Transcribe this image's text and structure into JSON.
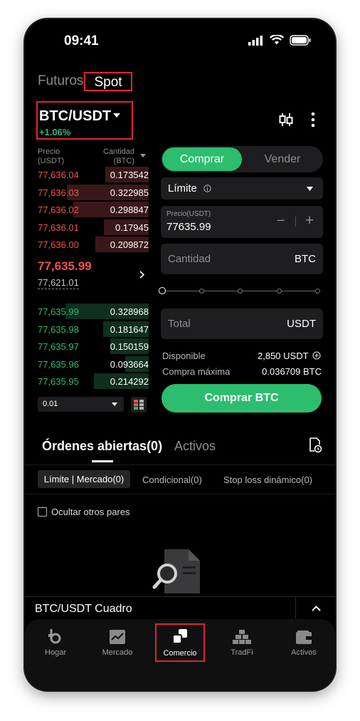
{
  "status_bar": {
    "time": "09:41"
  },
  "top_tabs": {
    "futures": "Futuros",
    "spot": "Spot"
  },
  "pair": {
    "name": "BTC/USDT",
    "change": "+1.06%"
  },
  "order_book": {
    "header_price": "Precio",
    "header_price_unit": "(USDT)",
    "header_qty": "Cantidad",
    "header_qty_unit": "(BTC)",
    "asks": [
      {
        "price": "77,636.04",
        "qty": "0.173542",
        "depth": 0.35
      },
      {
        "price": "77,636.03",
        "qty": "0.322985",
        "depth": 0.66
      },
      {
        "price": "77,636.02",
        "qty": "0.298847",
        "depth": 0.61
      },
      {
        "price": "77,636.01",
        "qty": "0.17945",
        "depth": 0.36
      },
      {
        "price": "77,636.00",
        "qty": "0.209872",
        "depth": 0.43
      }
    ],
    "last_price": "77,635.99",
    "mark_price": "77,621.01",
    "bids": [
      {
        "price": "77,635.99",
        "qty": "0.328968",
        "depth": 0.67
      },
      {
        "price": "77,635.98",
        "qty": "0.181647",
        "depth": 0.37
      },
      {
        "price": "77,635.97",
        "qty": "0.150159",
        "depth": 0.31
      },
      {
        "price": "77,635.96",
        "qty": "0.093664",
        "depth": 0.19
      },
      {
        "price": "77,635.95",
        "qty": "0.214292",
        "depth": 0.44
      }
    ],
    "precision": "0.01"
  },
  "trade_form": {
    "buy_label": "Comprar",
    "sell_label": "Vender",
    "order_type": "Límite",
    "price_label": "Precio(USDT)",
    "price_value": "77635.99",
    "minus": "−",
    "plus": "+",
    "amount_placeholder": "Cantidad",
    "amount_unit": "BTC",
    "total_placeholder": "Total",
    "total_unit": "USDT",
    "available_label": "Disponible",
    "available_value": "2,850 USDT",
    "max_buy_label": "Compra máxima",
    "max_buy_value": "0.036709 BTC",
    "submit_label": "Comprar BTC"
  },
  "orders_section": {
    "tab_open": "Órdenes abiertas(0)",
    "tab_assets": "Activos",
    "sub_tabs": [
      "Límite | Mercado(0)",
      "Condicional(0)",
      "Stop loss dinámico(0)"
    ],
    "hide_pairs": "Ocultar otros pares"
  },
  "chart_bar": {
    "label": "BTC/USDT Cuadro"
  },
  "bottom_nav": [
    "Hogar",
    "Mercado",
    "Comercio",
    "TradFi",
    "Activos"
  ],
  "colors": {
    "green": "#2dbd6e",
    "red": "#f0544f",
    "highlight": "#e0262b",
    "background": "#000000"
  }
}
